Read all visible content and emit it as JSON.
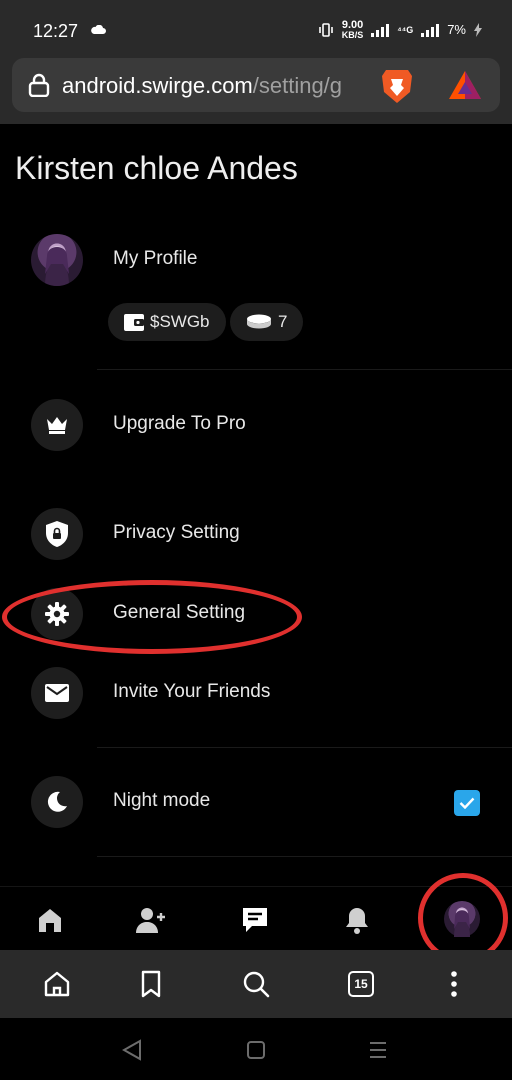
{
  "status_bar": {
    "time": "12:27",
    "net_speed_value": "9.00",
    "net_speed_unit": "KB/S",
    "network_type": "⁴⁴G",
    "battery": "7%"
  },
  "browser": {
    "url_host": "android.swirge.com",
    "url_path": "/setting/g",
    "tab_count": "15"
  },
  "page": {
    "title": "Kirsten chloe Andes"
  },
  "menu": {
    "my_profile": "My Profile",
    "wallet_chip": "$SWGb",
    "coins_chip": "7",
    "upgrade": "Upgrade To Pro",
    "privacy": "Privacy Setting",
    "general": "General Setting",
    "invite": "Invite Your Friends",
    "night_mode": "Night mode",
    "night_mode_checked": true
  },
  "icons": {
    "upgrade": "crown-icon",
    "privacy": "shield-lock-icon",
    "general": "gear-icon",
    "invite": "envelope-icon",
    "night_mode": "moon-icon"
  },
  "colors": {
    "annotation_red": "#e0302e",
    "checkbox_blue": "#2aa6ea"
  }
}
